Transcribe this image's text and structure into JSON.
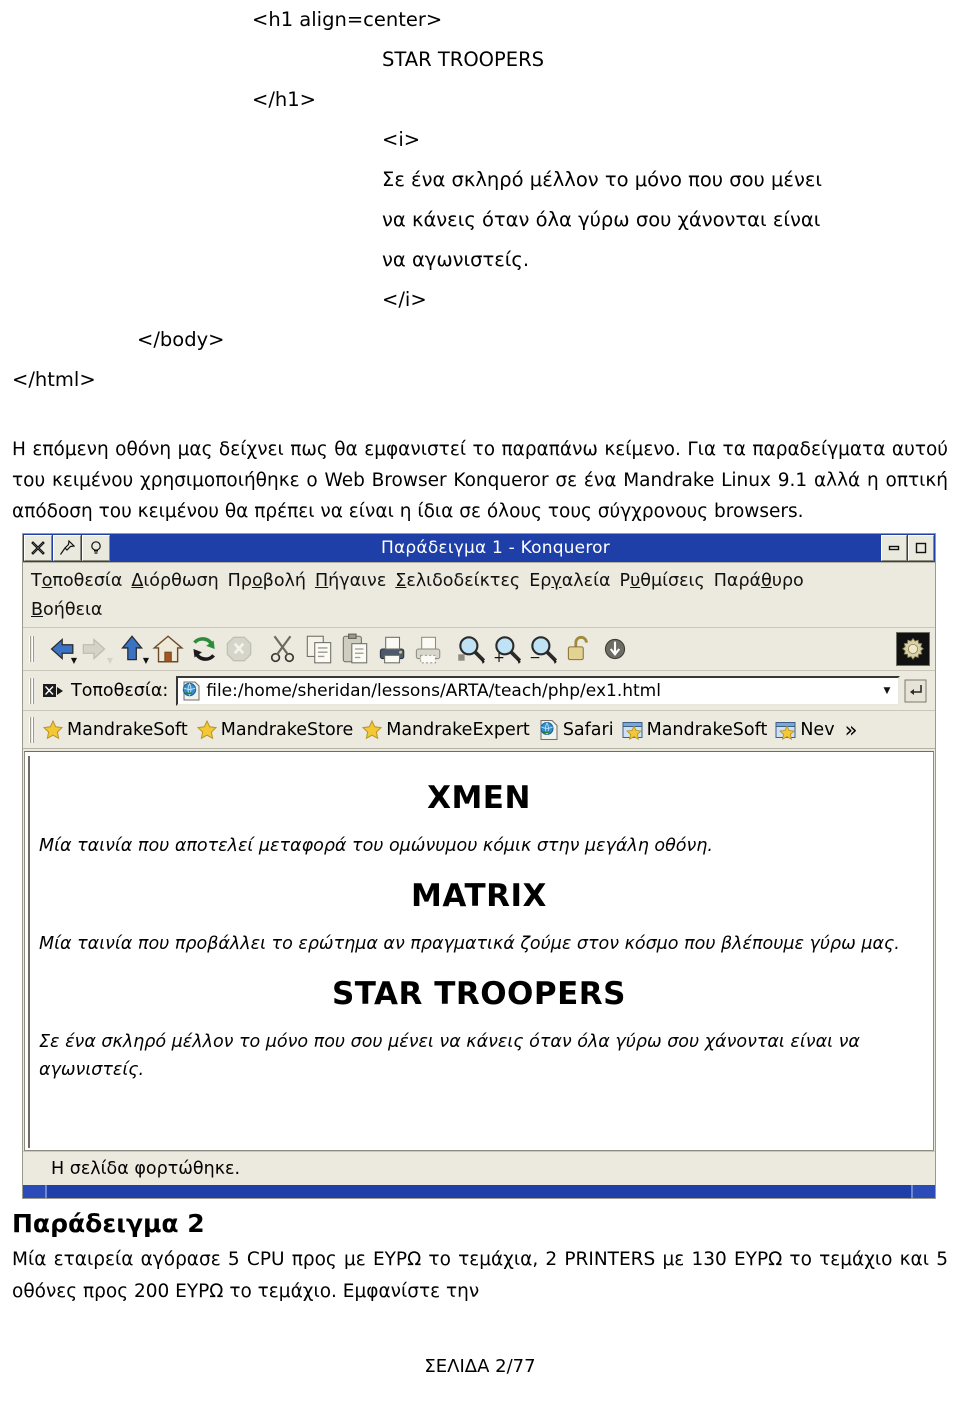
{
  "document": {
    "code_listing": [
      {
        "text": "<h1 align=center>",
        "indent": "ind-1"
      },
      {
        "text": "STAR TROOPERS",
        "indent": "ind-2"
      },
      {
        "text": "</h1>",
        "indent": "ind-1"
      },
      {
        "text": "<i>",
        "indent": "ind-2"
      },
      {
        "text": "Σε ένα σκληρό μέλλον το μόνο που σου μένει",
        "indent": "ind-2"
      },
      {
        "text": "να κάνεις όταν όλα γύρω σου χάνονται είναι",
        "indent": "ind-2"
      },
      {
        "text": "να αγωνιστείς.",
        "indent": "ind-2"
      },
      {
        "text": "</i>",
        "indent": "ind-2"
      },
      {
        "text": "</body>",
        "indent": "ind-body"
      },
      {
        "text": "</html>",
        "indent": "ind-0"
      }
    ],
    "intro_paragraph": "Η επόμενη οθόνη μας δείχνει πως θα εμφανιστεί το παραπάνω κείμενο. Για τα παραδείγματα αυτού του κειμένου χρησιμοποιήθηκε ο Web Browser Konqueror σε ένα Mandrake Linux 9.1 αλλά η οπτική απόδοση του κειμένου θα πρέπει να είναι η ίδια σε όλους τους σύγχρονους browsers.",
    "example2_title": "Παράδειγμα 2",
    "example2_text": "Μία εταιρεία αγόρασε 5 CPU προς με  ΕΥΡΩ το τεμάχια, 2 PRINTERS  με 130 ΕΥΡΩ το τεμάχιο  και 5 οθόνες προς 200 ΕΥΡΩ το τεμάχιο. Εμφανίστε την",
    "page_footer": "ΣΕΛΙΔΑ 2/77"
  },
  "browser": {
    "titlebar": {
      "title": "Παράδειγμα 1 - Konqueror",
      "left_buttons": [
        {
          "name": "close-button",
          "glyph": "✖"
        },
        {
          "name": "sticky-pin-button",
          "glyph": "📌"
        },
        {
          "name": "whats-this-button",
          "glyph": "?"
        }
      ],
      "right_buttons": [
        {
          "name": "minimize-button",
          "glyph": "–"
        },
        {
          "name": "maximize-button",
          "glyph": "□"
        }
      ],
      "bg_color": "#1f3fa8",
      "text_color": "#ffffff"
    },
    "menu": {
      "row1": [
        {
          "label": "Τοποθεσία",
          "accel_index": 1
        },
        {
          "label": "Διόρθωση",
          "accel_index": 0
        },
        {
          "label": "Προβολή",
          "accel_index": 2
        },
        {
          "label": "Πήγαινε",
          "accel_index": 0
        },
        {
          "label": "Σελιδοδείκτες",
          "accel_index": 0
        },
        {
          "label": "Εργαλεία",
          "accel_index": 2
        },
        {
          "label": "Ρυθμίσεις",
          "accel_index": 1
        },
        {
          "label": "Παράθυρο",
          "accel_index": 4
        }
      ],
      "row2": [
        {
          "label": "Βοήθεια",
          "accel_index": 0
        }
      ]
    },
    "toolbar": {
      "buttons": [
        {
          "name": "back-button",
          "icon": "arrow-left-icon",
          "enabled": true,
          "has_dropdown": true
        },
        {
          "name": "forward-button",
          "icon": "arrow-right-icon",
          "enabled": false,
          "has_dropdown": true
        },
        {
          "name": "up-button",
          "icon": "arrow-up-icon",
          "enabled": true,
          "has_dropdown": true
        },
        {
          "name": "home-button",
          "icon": "home-icon",
          "enabled": true,
          "has_dropdown": false
        },
        {
          "name": "reload-button",
          "icon": "reload-icon",
          "enabled": true,
          "has_dropdown": false
        },
        {
          "name": "stop-button",
          "icon": "stop-icon",
          "enabled": false,
          "has_dropdown": false
        },
        {
          "name": "cut-button",
          "icon": "scissors-icon",
          "enabled": true,
          "has_dropdown": false
        },
        {
          "name": "copy-button",
          "icon": "copy-icon",
          "enabled": true,
          "has_dropdown": false
        },
        {
          "name": "paste-button",
          "icon": "clipboard-paste-icon",
          "enabled": true,
          "has_dropdown": false
        },
        {
          "name": "print-button",
          "icon": "printer-icon",
          "enabled": true,
          "has_dropdown": false
        },
        {
          "name": "print-preview-button",
          "icon": "printer-preview-icon",
          "enabled": true,
          "has_dropdown": false
        },
        {
          "name": "find-button",
          "icon": "magnifier-find-icon",
          "enabled": true,
          "has_dropdown": false
        },
        {
          "name": "zoom-in-button",
          "icon": "magnifier-plus-icon",
          "enabled": true,
          "has_dropdown": false
        },
        {
          "name": "zoom-out-button",
          "icon": "magnifier-minus-icon",
          "enabled": true,
          "has_dropdown": false
        },
        {
          "name": "security-button",
          "icon": "padlock-open-icon",
          "enabled": true,
          "has_dropdown": false
        },
        {
          "name": "downloads-button",
          "icon": "download-arrow-icon",
          "enabled": true,
          "has_dropdown": false
        }
      ],
      "throbber_icon": "konqueror-gear-icon"
    },
    "location": {
      "label": "Τοποθεσία:",
      "clear_icon": "clear-location-icon",
      "favicon": "globe-page-icon",
      "url": "file:/home/sheridan/lessons/ARTA/teach/php/ex1.html",
      "dropdown_icon": "chevron-down-icon",
      "go_icon": "go-enter-icon"
    },
    "bookmarks": [
      {
        "label": "MandrakeSoft",
        "icon": "star-icon"
      },
      {
        "label": "MandrakeStore",
        "icon": "star-icon"
      },
      {
        "label": "MandrakeExpert",
        "icon": "star-icon"
      },
      {
        "label": "Safari",
        "icon": "globe-page-icon"
      },
      {
        "label": "MandrakeSoft",
        "icon": "folder-star-icon"
      },
      {
        "label": "Nev",
        "icon": "folder-star-icon"
      }
    ],
    "bookmarks_overflow": "»",
    "page": {
      "blocks": [
        {
          "type": "h1",
          "text": "XMEN"
        },
        {
          "type": "p",
          "text": "Μία ταινία που αποτελεί μεταφορά του ομώνυμου κόμικ στην μεγάλη οθόνη."
        },
        {
          "type": "h1",
          "text": "MATRIX"
        },
        {
          "type": "p",
          "text": "Μία ταινία που προβάλλει το ερώτημα αν πραγματικά ζούμε στον κόσμο που βλέπουμε γύρω μας."
        },
        {
          "type": "h1",
          "text": "STAR TROOPERS"
        },
        {
          "type": "p",
          "text": "Σε ένα σκληρό μέλλον το μόνο που σου μένει να κάνεις όταν όλα γύρω σου χάνονται είναι να αγωνιστείς."
        }
      ]
    },
    "statusbar": {
      "text": "Η σελίδα φορτώθηκε."
    }
  }
}
